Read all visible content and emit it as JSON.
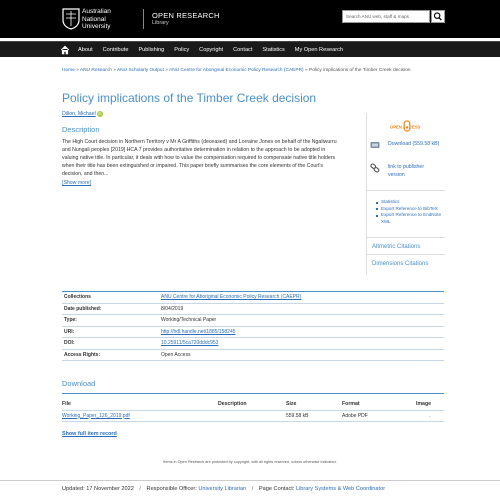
{
  "header": {
    "logo_line1": "Australian",
    "logo_line2": "National",
    "logo_line3": "University",
    "site_title": "OPEN RESEARCH",
    "site_subtitle": "Library",
    "search_placeholder": "Search ANU web, staff & maps"
  },
  "nav": {
    "items": [
      "About",
      "Contribute",
      "Publishing",
      "Policy",
      "Copyright",
      "Contact",
      "Statistics",
      "My Open Research"
    ]
  },
  "breadcrumb": {
    "home": "Home",
    "sep": "»",
    "anu_research": "ANU Research",
    "scholarly_output": "ANU Scholarly Output",
    "caepr": "ANU Centre for Aboriginal Economic Policy Research (CAEPR)",
    "current": "Policy implications of the Timber Creek decision"
  },
  "item": {
    "title": "Policy implications of the Timber Creek decision",
    "author": "Dillon, Michael",
    "orcid_label": "iD",
    "description_heading": "Description",
    "description": "The High Court decision in Northern Territory v Mr A Griffiths (deceased) and Lorraine Jones on behalf of the Ngaliwurru and Nungali peoples [2019] HCA 7 provides authoritative determination in relation to the approach to be adopted in valuing native title. In particular, it deals with how to value the compensation required to compensate native title holders when their title has been extinguished or impaired. This paper briefly summarises the core elements of the Court's decision, and then...",
    "show_more": "[Show more]"
  },
  "sidebar": {
    "badge_text": "OPEN ACCESS",
    "download_text": "Download (559.58 kB)",
    "publisher_link": "link to publisher version",
    "links": [
      "Statistics",
      "Export Reference to BibTeX",
      "Export Reference to EndNote XML"
    ],
    "altmetric": "Altmetric Citations",
    "dimensions": "Dimensions Citations"
  },
  "metadata": {
    "rows": [
      {
        "key": "Collections",
        "value": "ANU Centre for Aboriginal Economic Policy Research (CAEPR)",
        "link": true
      },
      {
        "key": "Date published:",
        "value": "8/04/2019",
        "link": false
      },
      {
        "key": "Type:",
        "value": "Working/Technical Paper",
        "link": false
      },
      {
        "key": "URI:",
        "value": "http://hdl.handle.net/1885/158245",
        "link": true
      },
      {
        "key": "DOI:",
        "value": "10.25911/5ca720dddc953",
        "link": true
      },
      {
        "key": "Access Rights:",
        "value": "Open Access",
        "link": false
      }
    ]
  },
  "download": {
    "heading": "Download",
    "columns": [
      "File",
      "Description",
      "Size",
      "Format",
      "Image"
    ],
    "file": "Working_Paper_126_2019.pdf",
    "description": "",
    "size": "559.58 kB",
    "format": "Adobe PDF",
    "image": ".",
    "show_full": "Show full item record"
  },
  "footer": {
    "copyright": "Items in Open Research are protected by copyright, with all rights reserved, unless otherwise indicated.",
    "updated_label": "Updated:",
    "updated_value": "17 November 2022",
    "officer_label": "Responsible Officer:",
    "officer_value": "University Librarian",
    "contact_label": "Page Contact:",
    "contact_value": "Library Systems & Web Coordinator",
    "sep": "/"
  },
  "colors": {
    "accent": "#4a90c8",
    "link": "#2a6ebb",
    "header_bg": "#000000",
    "nav_bg": "#1a1a1a",
    "oa_orange": "#f68212"
  },
  "icons": {
    "crest": "anu-crest-icon",
    "search": "search-icon",
    "home": "home-icon",
    "download": "download-icon",
    "link": "link-icon",
    "open_access": "open-access-icon"
  }
}
